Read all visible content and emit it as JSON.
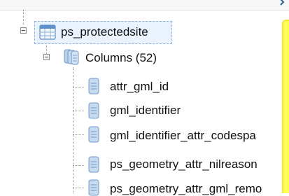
{
  "tree": {
    "table": {
      "label": "ps_protectedsite",
      "icon": "table-icon"
    },
    "columns_group": {
      "label": "Columns (52)",
      "icon": "columns-icon"
    },
    "columns": [
      {
        "label": "attr_gml_id",
        "icon": "column-icon"
      },
      {
        "label": "gml_identifier",
        "icon": "column-icon"
      },
      {
        "label": "gml_identifier_attr_codespa",
        "icon": "column-icon"
      },
      {
        "label": "ps_geometry_attr_nilreason",
        "icon": "column-icon"
      },
      {
        "label": "ps_geometry_attr_gml_remo",
        "icon": "column-icon"
      }
    ]
  },
  "colors": {
    "selection_bg": "#e9f2fd",
    "selection_border": "#8ab4e8",
    "column_icon": "#a7c4e4",
    "highlight_panel": "#ffff55"
  }
}
